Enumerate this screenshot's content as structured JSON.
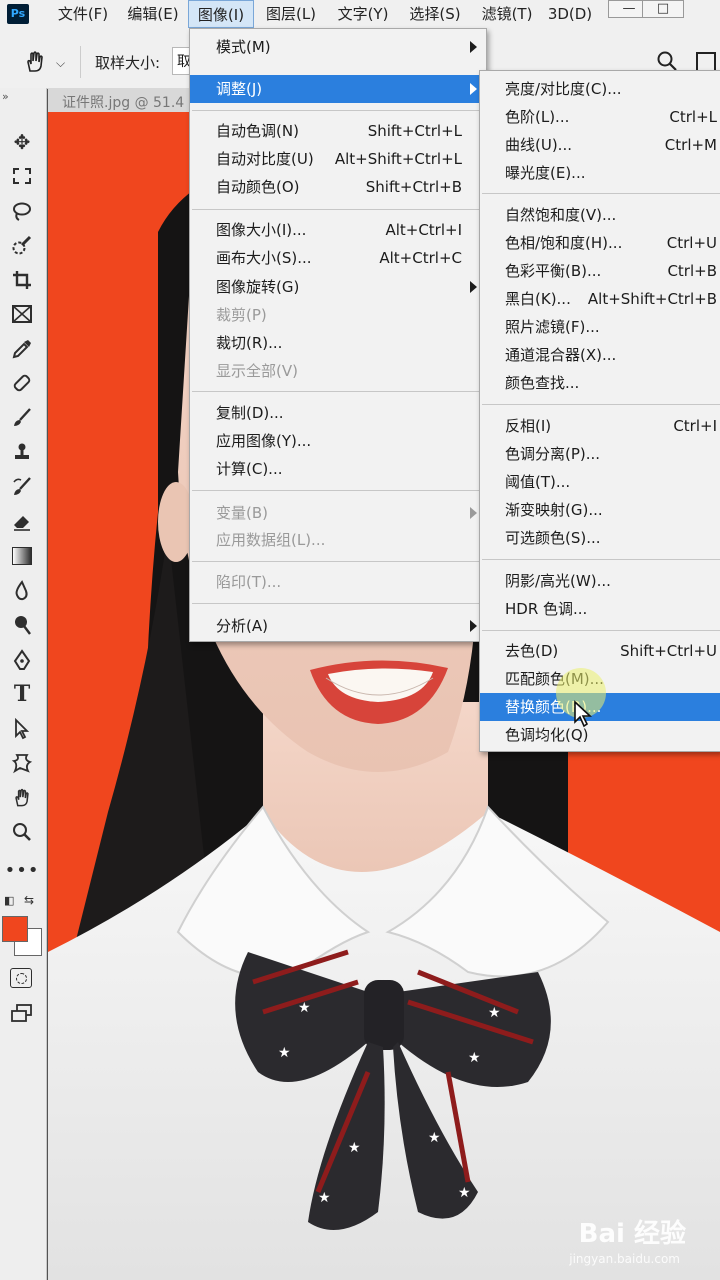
{
  "app": {
    "logo": "Ps"
  },
  "menubar": {
    "items": [
      "文件(F)",
      "编辑(E)",
      "图像(I)",
      "图层(L)",
      "文字(Y)",
      "选择(S)",
      "滤镜(T)",
      "3D(D)"
    ],
    "active_index": 2,
    "window_buttons": [
      "—",
      "□"
    ]
  },
  "options": {
    "sample_size_label": "取样大小:",
    "select_value": "取"
  },
  "document": {
    "tab": "证件照.jpg @ 51.4"
  },
  "image_menu": {
    "items": [
      {
        "label": "模式(M)",
        "shortcut": "",
        "submenu": true,
        "disabled": false
      },
      {
        "label": "调整(J)",
        "shortcut": "",
        "submenu": true,
        "disabled": false,
        "highlighted": true
      },
      {
        "label": "自动色调(N)",
        "shortcut": "Shift+Ctrl+L",
        "disabled": false
      },
      {
        "label": "自动对比度(U)",
        "shortcut": "Alt+Shift+Ctrl+L",
        "disabled": false
      },
      {
        "label": "自动颜色(O)",
        "shortcut": "Shift+Ctrl+B",
        "disabled": false
      },
      {
        "label": "图像大小(I)...",
        "shortcut": "Alt+Ctrl+I",
        "disabled": false
      },
      {
        "label": "画布大小(S)...",
        "shortcut": "Alt+Ctrl+C",
        "disabled": false
      },
      {
        "label": "图像旋转(G)",
        "shortcut": "",
        "submenu": true,
        "disabled": false
      },
      {
        "label": "裁剪(P)",
        "shortcut": "",
        "disabled": true
      },
      {
        "label": "裁切(R)...",
        "shortcut": "",
        "disabled": false
      },
      {
        "label": "显示全部(V)",
        "shortcut": "",
        "disabled": true
      },
      {
        "label": "复制(D)...",
        "shortcut": "",
        "disabled": false
      },
      {
        "label": "应用图像(Y)...",
        "shortcut": "",
        "disabled": false
      },
      {
        "label": "计算(C)...",
        "shortcut": "",
        "disabled": false
      },
      {
        "label": "变量(B)",
        "shortcut": "",
        "submenu": true,
        "disabled": true
      },
      {
        "label": "应用数据组(L)...",
        "shortcut": "",
        "disabled": true
      },
      {
        "label": "陷印(T)...",
        "shortcut": "",
        "disabled": true
      },
      {
        "label": "分析(A)",
        "shortcut": "",
        "submenu": true,
        "disabled": false
      }
    ]
  },
  "adjust_menu": {
    "items": [
      {
        "label": "亮度/对比度(C)...",
        "shortcut": ""
      },
      {
        "label": "色阶(L)...",
        "shortcut": "Ctrl+L"
      },
      {
        "label": "曲线(U)...",
        "shortcut": "Ctrl+M"
      },
      {
        "label": "曝光度(E)...",
        "shortcut": ""
      },
      {
        "label": "自然饱和度(V)...",
        "shortcut": ""
      },
      {
        "label": "色相/饱和度(H)...",
        "shortcut": "Ctrl+U"
      },
      {
        "label": "色彩平衡(B)...",
        "shortcut": "Ctrl+B"
      },
      {
        "label": "黑白(K)...",
        "shortcut": "Alt+Shift+Ctrl+B"
      },
      {
        "label": "照片滤镜(F)...",
        "shortcut": ""
      },
      {
        "label": "通道混合器(X)...",
        "shortcut": ""
      },
      {
        "label": "颜色查找...",
        "shortcut": ""
      },
      {
        "label": "反相(I)",
        "shortcut": "Ctrl+I"
      },
      {
        "label": "色调分离(P)...",
        "shortcut": ""
      },
      {
        "label": "阈值(T)...",
        "shortcut": ""
      },
      {
        "label": "渐变映射(G)...",
        "shortcut": ""
      },
      {
        "label": "可选颜色(S)...",
        "shortcut": ""
      },
      {
        "label": "阴影/高光(W)...",
        "shortcut": ""
      },
      {
        "label": "HDR 色调...",
        "shortcut": ""
      },
      {
        "label": "去色(D)",
        "shortcut": "Shift+Ctrl+U"
      },
      {
        "label": "匹配颜色(M)...",
        "shortcut": ""
      },
      {
        "label": "替换颜色(R)...",
        "shortcut": "",
        "highlighted": true
      },
      {
        "label": "色调均化(Q)",
        "shortcut": ""
      }
    ]
  },
  "colors": {
    "accent": "#2b7fde",
    "foreground": "#f0461e",
    "background": "#ffffff",
    "canvas_bg": "#f0461e"
  },
  "watermark": {
    "text": "Bai 经验",
    "sub": "jingyan.baidu.com"
  }
}
